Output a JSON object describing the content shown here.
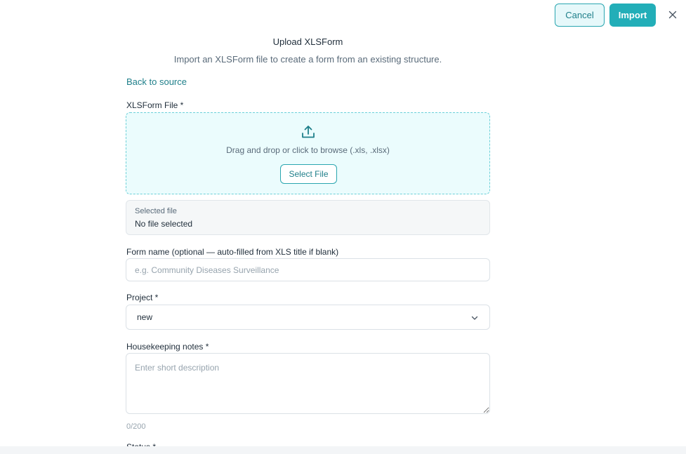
{
  "header": {
    "cancel_label": "Cancel",
    "import_label": "Import",
    "close_icon": "close-icon"
  },
  "page": {
    "title": "Upload XLSForm",
    "subtitle": "Import an XLSForm file to create a form from an existing structure.",
    "back_link": "Back to source"
  },
  "file_upload": {
    "label": "XLSForm File *",
    "icon": "upload-icon",
    "drop_text": "Drag and drop or click to browse (.xls, .xlsx)",
    "select_button": "Select File",
    "selected_label": "Selected file",
    "selected_value": "No file selected"
  },
  "form_name": {
    "label": "Form name (optional — auto-filled from XLS title if blank)",
    "placeholder": "e.g. Community Diseases Surveillance",
    "value": ""
  },
  "project": {
    "label": "Project *",
    "selected": "new",
    "icon": "chevron-down-icon"
  },
  "notes": {
    "label": "Housekeeping notes *",
    "placeholder": "Enter short description",
    "value": "",
    "counter": "0/200"
  },
  "status": {
    "label": "Status *"
  },
  "colors": {
    "accent": "#22aeb8",
    "accent_dark": "#1f7f8a",
    "dropzone_bg": "#ebfcfd"
  }
}
